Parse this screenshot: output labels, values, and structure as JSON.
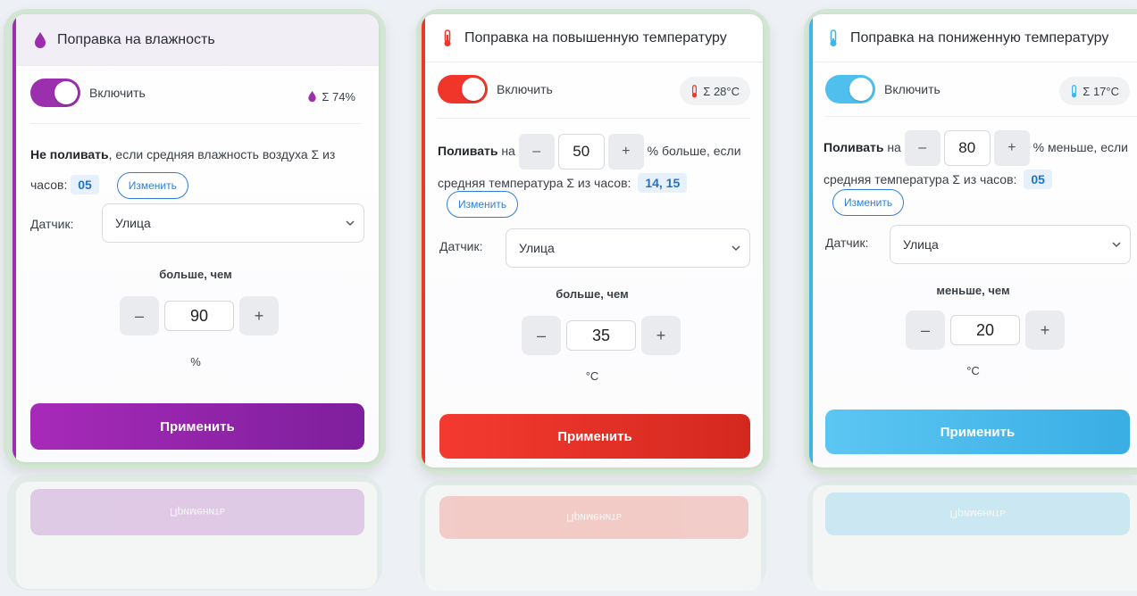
{
  "cards": [
    {
      "title": "Поправка на влажность",
      "icon": "drop-icon",
      "color": "#9b2fae",
      "toggle_label": "Включить",
      "badge_icon": "drop-icon",
      "badge_text": "Σ 74%",
      "desc_strong": "Не поливать",
      "desc_text": ", если средняя влажность воздуха Σ из часов:",
      "hours": "05",
      "change_label": "Изменить",
      "sensor_label": "Датчик:",
      "sensor_value": "Улица",
      "compare_label": "больше, чем",
      "value": "90",
      "unit": "%",
      "minus": "–",
      "plus": "+",
      "apply_label": "Применить",
      "reflect_label": "Применить"
    },
    {
      "title": "Поправка на повышенную температуру",
      "icon": "thermometer-hot-icon",
      "color": "#f0352a",
      "toggle_label": "Включить",
      "badge_icon": "thermometer-hot-icon",
      "badge_text": "Σ 28°C",
      "desc_strong": "Поливать",
      "desc_pre": "на",
      "desc_amount": "50",
      "desc_post": "% больше, если",
      "desc_text": "средняя температура Σ из часов:",
      "hours": "14, 15",
      "change_label": "Изменить",
      "sensor_label": "Датчик:",
      "sensor_value": "Улица",
      "compare_label": "больше, чем",
      "value": "35",
      "unit": "°C",
      "minus": "–",
      "plus": "+",
      "apply_label": "Применить",
      "reflect_label": "Применить"
    },
    {
      "title": "Поправка на пониженную температуру",
      "icon": "thermometer-cold-icon",
      "color": "#3fb3ea",
      "toggle_label": "Включить",
      "badge_icon": "thermometer-cold-icon",
      "badge_text": "Σ 17°C",
      "desc_strong": "Поливать",
      "desc_pre": "на",
      "desc_amount": "80",
      "desc_post": "% меньше, если",
      "desc_text": "средняя температура Σ из часов:",
      "hours": "05",
      "change_label": "Изменить",
      "sensor_label": "Датчик:",
      "sensor_value": "Улица",
      "compare_label": "меньше, чем",
      "value": "20",
      "unit": "°C",
      "minus": "–",
      "plus": "+",
      "apply_label": "Применить",
      "reflect_label": "Применить"
    }
  ]
}
